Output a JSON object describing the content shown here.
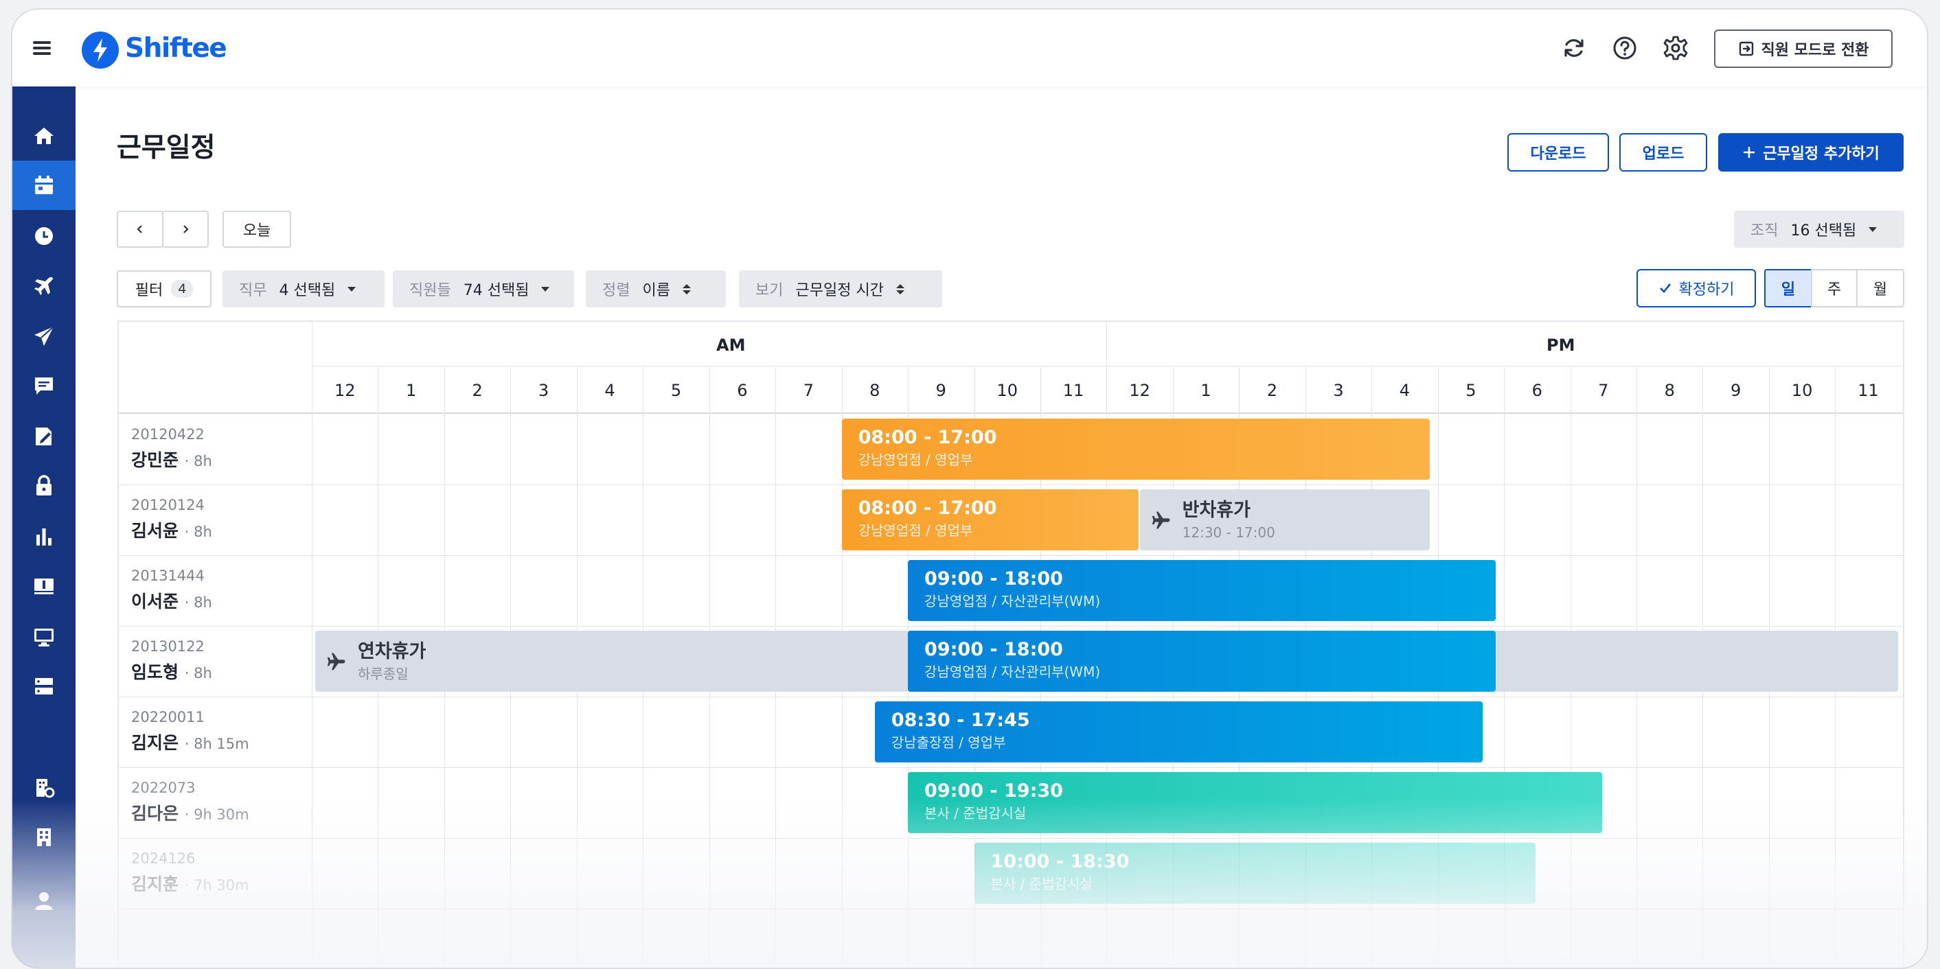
{
  "app": {
    "brand": "Shiftee",
    "switch_mode_label": "직원 모드로 전환"
  },
  "page": {
    "title": "근무일정"
  },
  "actions": {
    "download": "다운로드",
    "upload": "업로드",
    "add": "근무일정 추가하기"
  },
  "nav_controls": {
    "today": "오늘"
  },
  "org_filter": {
    "label": "조직",
    "value": "16 선택됨"
  },
  "filters": {
    "filter_label": "필터",
    "filter_count": "4",
    "job": {
      "label": "직무",
      "value": "4 선택됨"
    },
    "staff": {
      "label": "직원들",
      "value": "74 선택됨"
    },
    "sort": {
      "label": "정렬",
      "value": "이름"
    },
    "view": {
      "label": "보기",
      "value": "근무일정 시간"
    }
  },
  "confirm_label": "확정하기",
  "view_modes": [
    {
      "label": "일",
      "active": true
    },
    {
      "label": "주",
      "active": false
    },
    {
      "label": "월",
      "active": false
    }
  ],
  "schedule": {
    "am_label": "AM",
    "pm_label": "PM",
    "hours": [
      "12",
      "1",
      "2",
      "3",
      "4",
      "5",
      "6",
      "7",
      "8",
      "9",
      "10",
      "11",
      "12",
      "1",
      "2",
      "3",
      "4",
      "5",
      "6",
      "7",
      "8",
      "9",
      "10",
      "11"
    ],
    "employees": [
      {
        "id": "20120422",
        "name": "강민준",
        "hours": "· 8h"
      },
      {
        "id": "20120124",
        "name": "김서윤",
        "hours": "· 8h"
      },
      {
        "id": "20131444",
        "name": "이서준",
        "hours": "· 8h"
      },
      {
        "id": "20130122",
        "name": "임도형",
        "hours": "· 8h"
      },
      {
        "id": "20220011",
        "name": "김지은",
        "hours": "· 8h 15m"
      },
      {
        "id": "2022073",
        "name": "김다은",
        "hours": "· 9h 30m"
      },
      {
        "id": "2024126",
        "name": "김지훈",
        "hours": "· 7h 30m"
      }
    ],
    "shifts": [
      {
        "row": 0,
        "start": 8.0,
        "end": 16.9,
        "color": "orange",
        "time": "08:00 - 17:00",
        "place": "강남영업점 / 영업부"
      },
      {
        "row": 1,
        "start": 8.0,
        "end": 12.5,
        "color": "orange",
        "time": "08:00 - 17:00",
        "place": "강남영업점 / 영업부"
      },
      {
        "row": 1,
        "start": 12.5,
        "end": 16.9,
        "color": "leave",
        "time": "반차휴가",
        "place": "12:30 - 17:00"
      },
      {
        "row": 2,
        "start": 9.0,
        "end": 17.9,
        "color": "blue",
        "time": "09:00 - 18:00",
        "place": "강남영업점 / 자산관리부(WM)"
      },
      {
        "row": 3,
        "start": 0.0,
        "end": 24.0,
        "color": "leave",
        "time": "연차휴가",
        "place": "하루종일"
      },
      {
        "row": 3,
        "start": 9.0,
        "end": 17.9,
        "color": "blue",
        "time": "09:00 - 18:00",
        "place": "강남영업점 / 자산관리부(WM)"
      },
      {
        "row": 4,
        "start": 8.5,
        "end": 17.7,
        "color": "blue",
        "time": "08:30 - 17:45",
        "place": "강남출장점 / 영업부"
      },
      {
        "row": 5,
        "start": 9.0,
        "end": 19.5,
        "color": "teal",
        "time": "09:00 - 19:30",
        "place": "본사 / 준법감시실"
      },
      {
        "row": 6,
        "start": 10.0,
        "end": 18.5,
        "color": "teal",
        "time": "10:00 - 18:30",
        "place": "본사 / 준법감시실"
      }
    ]
  }
}
